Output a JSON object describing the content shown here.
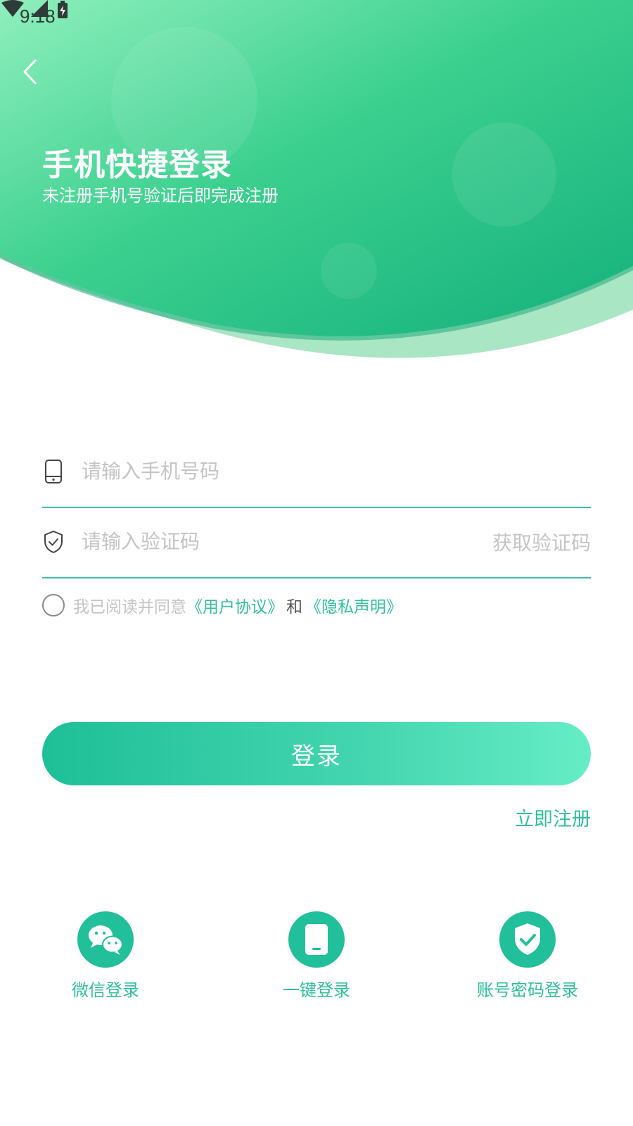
{
  "status_bar": {
    "time": "9:18",
    "icons": [
      "wifi-icon",
      "signal-icon",
      "battery-charging-icon"
    ]
  },
  "header": {
    "back_icon": "chevron-left-icon",
    "title": "手机快捷登录",
    "subtitle": "未注册手机号验证后即完成注册"
  },
  "form": {
    "phone_placeholder": "请输入手机号码",
    "phone_value": "",
    "phone_icon": "phone-icon",
    "code_placeholder": "请输入验证码",
    "code_value": "",
    "code_icon": "shield-check-icon",
    "get_code_label": "获取验证码"
  },
  "agreement": {
    "checked": false,
    "prefix": "我已阅读并同意",
    "user_agreement": "《用户协议》",
    "and": "和",
    "privacy": "《隐私声明》"
  },
  "actions": {
    "login_label": "登录",
    "register_label": "立即注册"
  },
  "alt_logins": [
    {
      "label": "微信登录",
      "icon": "wechat-icon"
    },
    {
      "label": "一键登录",
      "icon": "phone-icon"
    },
    {
      "label": "账号密码登录",
      "icon": "shield-check-icon"
    }
  ],
  "colors": {
    "accent": "#21bf9a",
    "accent_light": "#66edc6",
    "link": "#2fbf9e",
    "placeholder": "#c4c4c4",
    "underline": "#3cbfa4"
  }
}
